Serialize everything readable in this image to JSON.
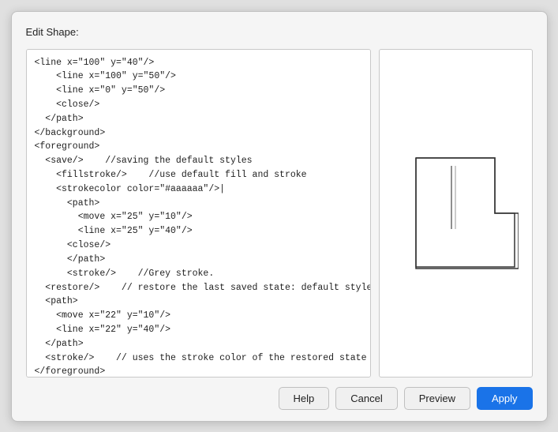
{
  "dialog": {
    "title": "Edit Shape:",
    "code_content": "<line x=\"100\" y=\"40\"/>\n    <line x=\"100\" y=\"50\"/>\n    <line x=\"0\" y=\"50\"/>\n    <close/>\n  </path>\n</background>\n<foreground>\n  <save/>    //saving the default styles\n    <fillstroke/>    //use default fill and stroke\n    <strokecolor color=\"#aaaaaa\"/>|\n      <path>\n        <move x=\"25\" y=\"10\"/>\n        <line x=\"25\" y=\"40\"/>\n      <close/>\n      </path>\n      <stroke/>    //Grey stroke.\n  <restore/>    // restore the last saved state: default styles\n  <path>\n    <move x=\"22\" y=\"10\"/>\n    <line x=\"22\" y=\"40\"/>\n  </path>\n  <stroke/>    // uses the stroke color of the restored state\n</foreground>\n</shape>",
    "footer": {
      "help_label": "Help",
      "cancel_label": "Cancel",
      "preview_label": "Preview",
      "apply_label": "Apply"
    }
  }
}
